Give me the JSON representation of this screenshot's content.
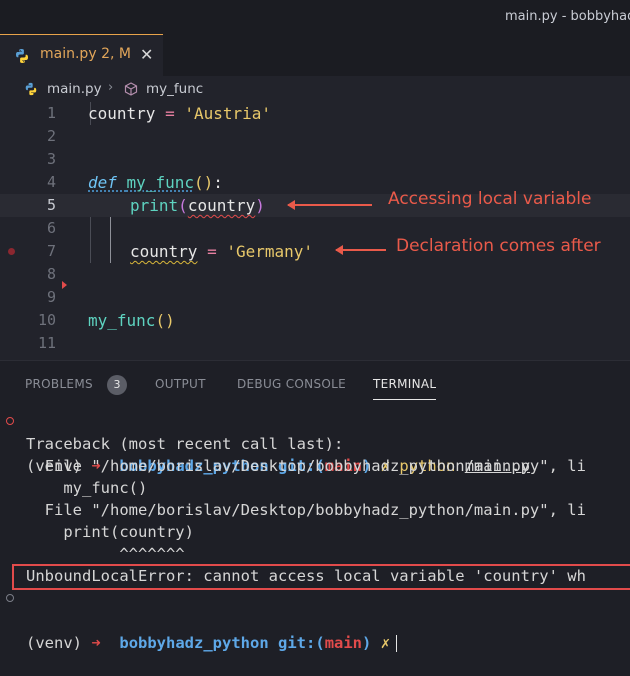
{
  "window": {
    "title": "main.py - bobbyhadz"
  },
  "tab": {
    "icon": "python-icon",
    "label": "main.py",
    "status": "2, M",
    "close": "✕"
  },
  "breadcrumb": {
    "file": "main.py",
    "separator": "›",
    "symbol_icon": "cube-icon",
    "symbol": "my_func"
  },
  "editor": {
    "line_numbers": [
      "1",
      "2",
      "3",
      "4",
      "5",
      "6",
      "7",
      "8",
      "9",
      "10",
      "11"
    ],
    "lines": {
      "l1": {
        "var": "country",
        "op": "=",
        "val": "'Austria'"
      },
      "l4": {
        "kw": "def",
        "name": "my_func",
        "parens": "()",
        "colon": ":"
      },
      "l5": {
        "fn": "print",
        "open": "(",
        "arg": "country",
        "close": ")"
      },
      "l7": {
        "var": "country",
        "op": "=",
        "val": "'Germany'"
      },
      "l10": {
        "call": "my_func",
        "parens": "()"
      }
    }
  },
  "annotations": {
    "access": "Accessing local variable",
    "declaration": "Declaration comes after"
  },
  "panel": {
    "tabs": [
      "PROBLEMS",
      "OUTPUT",
      "DEBUG CONSOLE",
      "TERMINAL"
    ],
    "problems_count": "3"
  },
  "terminal": {
    "prompt1": {
      "venv": "(venv)",
      "arrow": "➜",
      "dir": "bobbyhadz_python",
      "git": "git:(",
      "branch": "main",
      "git_close": ")",
      "x": "✗",
      "cmd": "python",
      "arg": "main.py"
    },
    "lines": [
      "Traceback (most recent call last):",
      "  File \"/home/borislav/Desktop/bobbyhadz_python/main.py\", li",
      "    my_func()",
      "  File \"/home/borislav/Desktop/bobbyhadz_python/main.py\", li",
      "    print(country)",
      "          ^^^^^^^"
    ],
    "error": "UnboundLocalError: cannot access local variable 'country' wh",
    "prompt2": {
      "venv": "(venv)",
      "arrow": "➜",
      "dir": "bobbyhadz_python",
      "git": "git:(",
      "branch": "main",
      "git_close": ")",
      "x": "✗"
    }
  },
  "colors": {
    "accent": "#e2a65a",
    "annotation": "#ea5a4a",
    "background": "#22232b"
  }
}
